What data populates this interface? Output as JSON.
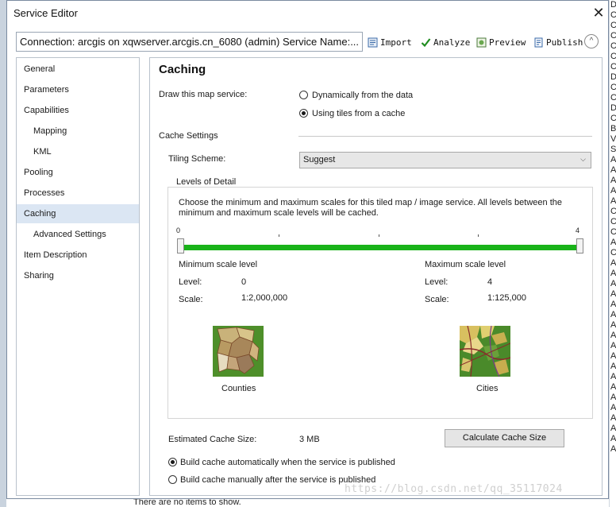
{
  "window": {
    "title": "Service Editor",
    "close_glyph": "✕"
  },
  "toolbar": {
    "connection": "Connection: arcgis on xqwserver.arcgis.cn_6080 (admin)   Service Name:...",
    "import_label": "Import",
    "analyze_label": "Analyze",
    "preview_label": "Preview",
    "publish_label": "Publish",
    "collapse_glyph": "^"
  },
  "nav": {
    "items": [
      {
        "label": "General"
      },
      {
        "label": "Parameters"
      },
      {
        "label": "Capabilities"
      },
      {
        "label": "Mapping"
      },
      {
        "label": "KML"
      },
      {
        "label": "Pooling"
      },
      {
        "label": "Processes"
      },
      {
        "label": "Caching"
      },
      {
        "label": "Advanced Settings"
      },
      {
        "label": "Item Description"
      },
      {
        "label": "Sharing"
      }
    ],
    "selected": "Caching"
  },
  "caching": {
    "heading": "Caching",
    "draw_label": "Draw this map service:",
    "opt_dynamic": "Dynamically from the data",
    "opt_tiles": "Using tiles from a cache",
    "cache_settings": "Cache Settings",
    "tiling_label": "Tiling Scheme:",
    "tiling_value": "Suggest",
    "levels_title": "Levels of Detail",
    "levels_desc": "Choose the minimum and maximum scales for this tiled map / image service. All levels between the minimum and maximum scale levels will be cached.",
    "slider_min_label": "0",
    "slider_max_label": "4",
    "min_title": "Minimum scale level",
    "max_title": "Maximum scale level",
    "level_label": "Level:",
    "scale_label": "Scale:",
    "min_level": "0",
    "min_scale": "1:2,000,000",
    "max_level": "4",
    "max_scale": "1:125,000",
    "counties_caption": "Counties",
    "cities_caption": "Cities",
    "est_label": "Estimated Cache Size:",
    "est_value": "3 MB",
    "calc_button": "Calculate Cache Size",
    "build_auto": "Build cache automatically when the service is published",
    "build_manual": "Build cache manually after the service is published"
  },
  "background": {
    "below_text": "There are no items to show.",
    "right_letters": [
      "D",
      "C",
      "C",
      "C",
      "C",
      "C",
      "C",
      "D",
      "C",
      "C",
      "D",
      "C",
      "B",
      "V",
      "S",
      "A",
      "A",
      "A",
      "A",
      "A",
      "C",
      "C",
      "C",
      "A",
      "C",
      "A",
      "A",
      "A",
      "A",
      "A",
      "A",
      "A",
      "A",
      "A",
      "A",
      "A",
      "A",
      "A",
      "A",
      "A",
      "A",
      "A",
      "A",
      "A"
    ],
    "watermark": "https://blog.csdn.net/qq_35117024"
  },
  "colors": {
    "slider": "#19b319",
    "selection": "#dbe6f3"
  }
}
